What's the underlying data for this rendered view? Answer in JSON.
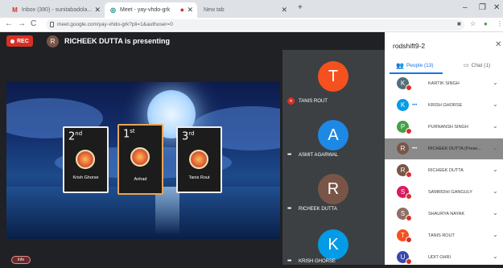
{
  "browser": {
    "tabs": [
      {
        "label": "Inbox (390) - sunitabadola...",
        "icon": "gmail-icon",
        "active": false
      },
      {
        "label": "Meet - yay-vhdo-grk",
        "icon": "meet-icon",
        "active": true
      },
      {
        "label": "New tab",
        "icon": "",
        "active": false
      }
    ],
    "url": "meet.google.com/yay-vhdo-grk?pli=1&authuser=0",
    "new_tab": "+",
    "window_controls": [
      "–",
      "❐",
      "✕"
    ],
    "nav": {
      "back": "←",
      "forward": "→",
      "reload": "C"
    }
  },
  "meet": {
    "rec_label": "REC",
    "presenter_initial": "R",
    "presenting_text": "RICHEEK DUTTA is presenting",
    "podium": [
      {
        "rank": "2",
        "suffix": "nd",
        "name": "Krish Ghorse"
      },
      {
        "rank": "1",
        "suffix": "st",
        "name": "Anhad"
      },
      {
        "rank": "3",
        "suffix": "rd",
        "name": "Tanis Rout"
      }
    ],
    "info_label": "Info",
    "tiles": [
      {
        "initial": "T",
        "name": "TANIS ROUT",
        "color": "#f4511e",
        "muted": true
      },
      {
        "initial": "A",
        "name": "ASMIT AGARWAL",
        "color": "#1e88e5",
        "muted": false
      },
      {
        "initial": "R",
        "name": "RICHEEK DUTTA",
        "color": "#795548",
        "muted": false
      },
      {
        "initial": "K",
        "name": "KRISH GHORSE",
        "color": "#039be5",
        "muted": false
      }
    ]
  },
  "panel": {
    "title": "rodshift9-2",
    "close": "✕",
    "people_tab": "People (13)",
    "chat_tab": "Chat (1)",
    "people": [
      {
        "initial": "K",
        "name": "KARTIK SINGH",
        "color": "#546e7a",
        "muted": true
      },
      {
        "initial": "K",
        "name": "KRISH GHORSE",
        "color": "#039be5",
        "muted": false
      },
      {
        "initial": "P",
        "name": "PURNANSH SINGH",
        "color": "#43a047",
        "muted": true
      },
      {
        "initial": "R",
        "name": "RICHEEK DUTTA (Prese...",
        "color": "#795548",
        "muted": false
      },
      {
        "initial": "R",
        "name": "RICHEEK DUTTA",
        "color": "#795548",
        "muted": true
      },
      {
        "initial": "S",
        "name": "SAMRIDHI GANGULY",
        "color": "#d81b60",
        "muted": true
      },
      {
        "initial": "S",
        "name": "SHAURYA NAYAK",
        "color": "#8d6e63",
        "muted": true
      },
      {
        "initial": "T",
        "name": "TANIS ROUT",
        "color": "#f4511e",
        "muted": true
      },
      {
        "initial": "U",
        "name": "UDIT OHRI",
        "color": "#3949ab",
        "muted": true
      }
    ]
  }
}
